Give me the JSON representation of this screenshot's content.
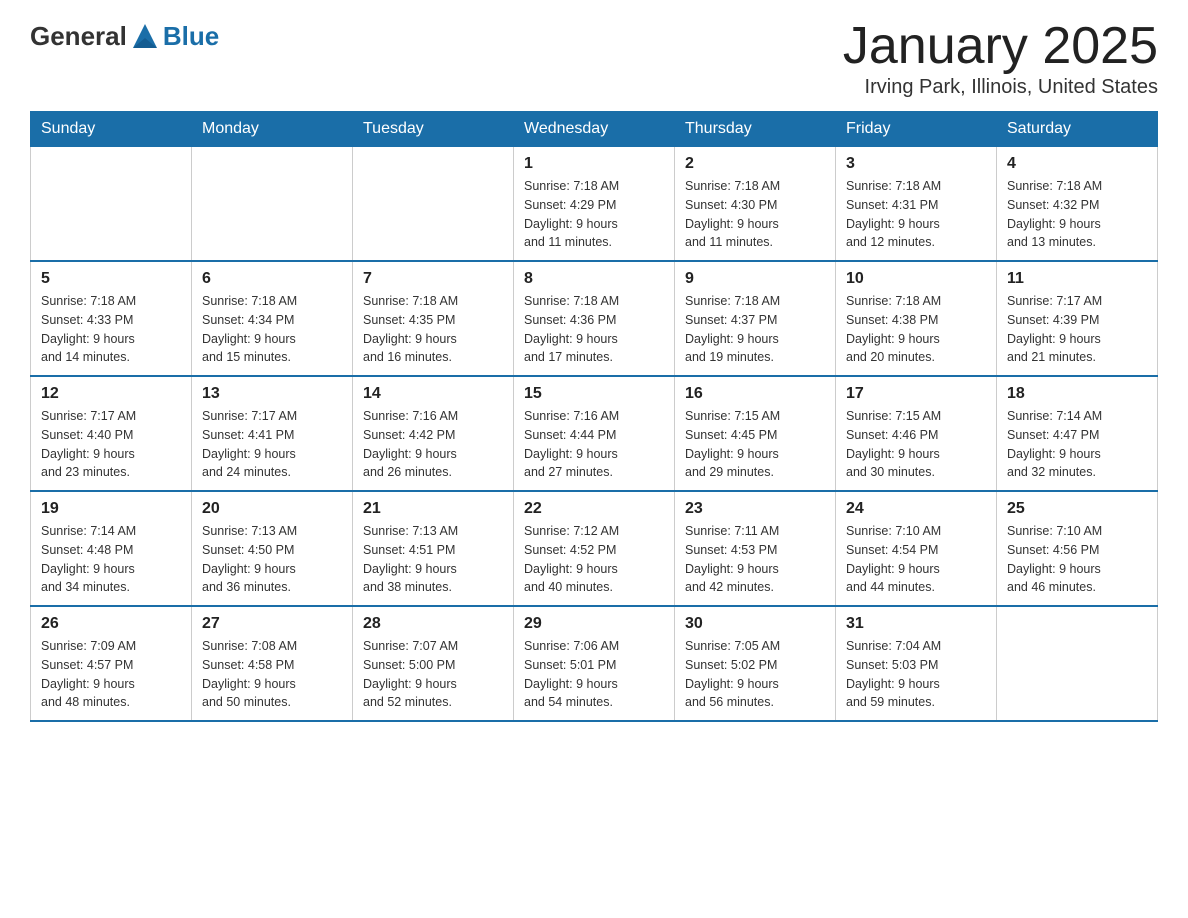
{
  "logo": {
    "text_general": "General",
    "text_blue": "Blue"
  },
  "title": "January 2025",
  "location": "Irving Park, Illinois, United States",
  "days_of_week": [
    "Sunday",
    "Monday",
    "Tuesday",
    "Wednesday",
    "Thursday",
    "Friday",
    "Saturday"
  ],
  "weeks": [
    [
      {
        "day": "",
        "info": ""
      },
      {
        "day": "",
        "info": ""
      },
      {
        "day": "",
        "info": ""
      },
      {
        "day": "1",
        "sunrise": "7:18 AM",
        "sunset": "4:29 PM",
        "daylight": "9 hours and 11 minutes."
      },
      {
        "day": "2",
        "sunrise": "7:18 AM",
        "sunset": "4:30 PM",
        "daylight": "9 hours and 11 minutes."
      },
      {
        "day": "3",
        "sunrise": "7:18 AM",
        "sunset": "4:31 PM",
        "daylight": "9 hours and 12 minutes."
      },
      {
        "day": "4",
        "sunrise": "7:18 AM",
        "sunset": "4:32 PM",
        "daylight": "9 hours and 13 minutes."
      }
    ],
    [
      {
        "day": "5",
        "sunrise": "7:18 AM",
        "sunset": "4:33 PM",
        "daylight": "9 hours and 14 minutes."
      },
      {
        "day": "6",
        "sunrise": "7:18 AM",
        "sunset": "4:34 PM",
        "daylight": "9 hours and 15 minutes."
      },
      {
        "day": "7",
        "sunrise": "7:18 AM",
        "sunset": "4:35 PM",
        "daylight": "9 hours and 16 minutes."
      },
      {
        "day": "8",
        "sunrise": "7:18 AM",
        "sunset": "4:36 PM",
        "daylight": "9 hours and 17 minutes."
      },
      {
        "day": "9",
        "sunrise": "7:18 AM",
        "sunset": "4:37 PM",
        "daylight": "9 hours and 19 minutes."
      },
      {
        "day": "10",
        "sunrise": "7:18 AM",
        "sunset": "4:38 PM",
        "daylight": "9 hours and 20 minutes."
      },
      {
        "day": "11",
        "sunrise": "7:17 AM",
        "sunset": "4:39 PM",
        "daylight": "9 hours and 21 minutes."
      }
    ],
    [
      {
        "day": "12",
        "sunrise": "7:17 AM",
        "sunset": "4:40 PM",
        "daylight": "9 hours and 23 minutes."
      },
      {
        "day": "13",
        "sunrise": "7:17 AM",
        "sunset": "4:41 PM",
        "daylight": "9 hours and 24 minutes."
      },
      {
        "day": "14",
        "sunrise": "7:16 AM",
        "sunset": "4:42 PM",
        "daylight": "9 hours and 26 minutes."
      },
      {
        "day": "15",
        "sunrise": "7:16 AM",
        "sunset": "4:44 PM",
        "daylight": "9 hours and 27 minutes."
      },
      {
        "day": "16",
        "sunrise": "7:15 AM",
        "sunset": "4:45 PM",
        "daylight": "9 hours and 29 minutes."
      },
      {
        "day": "17",
        "sunrise": "7:15 AM",
        "sunset": "4:46 PM",
        "daylight": "9 hours and 30 minutes."
      },
      {
        "day": "18",
        "sunrise": "7:14 AM",
        "sunset": "4:47 PM",
        "daylight": "9 hours and 32 minutes."
      }
    ],
    [
      {
        "day": "19",
        "sunrise": "7:14 AM",
        "sunset": "4:48 PM",
        "daylight": "9 hours and 34 minutes."
      },
      {
        "day": "20",
        "sunrise": "7:13 AM",
        "sunset": "4:50 PM",
        "daylight": "9 hours and 36 minutes."
      },
      {
        "day": "21",
        "sunrise": "7:13 AM",
        "sunset": "4:51 PM",
        "daylight": "9 hours and 38 minutes."
      },
      {
        "day": "22",
        "sunrise": "7:12 AM",
        "sunset": "4:52 PM",
        "daylight": "9 hours and 40 minutes."
      },
      {
        "day": "23",
        "sunrise": "7:11 AM",
        "sunset": "4:53 PM",
        "daylight": "9 hours and 42 minutes."
      },
      {
        "day": "24",
        "sunrise": "7:10 AM",
        "sunset": "4:54 PM",
        "daylight": "9 hours and 44 minutes."
      },
      {
        "day": "25",
        "sunrise": "7:10 AM",
        "sunset": "4:56 PM",
        "daylight": "9 hours and 46 minutes."
      }
    ],
    [
      {
        "day": "26",
        "sunrise": "7:09 AM",
        "sunset": "4:57 PM",
        "daylight": "9 hours and 48 minutes."
      },
      {
        "day": "27",
        "sunrise": "7:08 AM",
        "sunset": "4:58 PM",
        "daylight": "9 hours and 50 minutes."
      },
      {
        "day": "28",
        "sunrise": "7:07 AM",
        "sunset": "5:00 PM",
        "daylight": "9 hours and 52 minutes."
      },
      {
        "day": "29",
        "sunrise": "7:06 AM",
        "sunset": "5:01 PM",
        "daylight": "9 hours and 54 minutes."
      },
      {
        "day": "30",
        "sunrise": "7:05 AM",
        "sunset": "5:02 PM",
        "daylight": "9 hours and 56 minutes."
      },
      {
        "day": "31",
        "sunrise": "7:04 AM",
        "sunset": "5:03 PM",
        "daylight": "9 hours and 59 minutes."
      },
      {
        "day": "",
        "info": ""
      }
    ]
  ]
}
